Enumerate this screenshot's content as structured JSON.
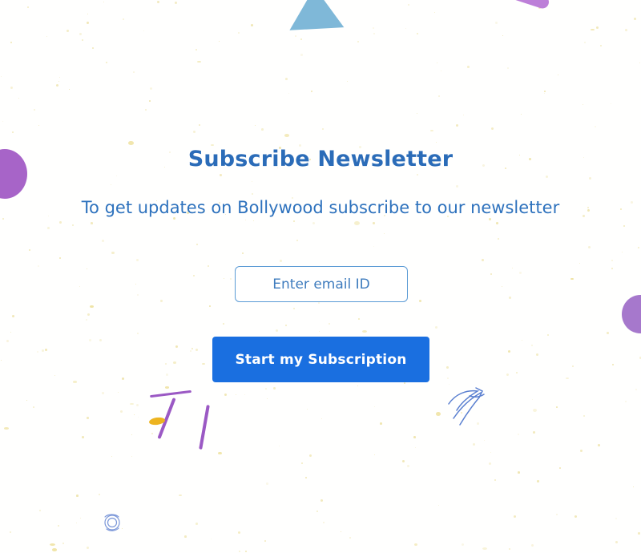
{
  "page": {
    "background_color": "#fffffe"
  },
  "newsletter": {
    "heading": "Subscribe Newsletter",
    "subheading": "To get updates on Bollywood subscribe to our newsletter",
    "email_input": {
      "placeholder": "Enter email ID",
      "value": "",
      "border_color": "#5b9bd5"
    },
    "submit_button": {
      "label": "Start my Subscription",
      "background_color": "#1a6fe0",
      "text_color": "#ffffff"
    },
    "heading_color": "#2b6cb8",
    "subheading_color": "#2e72bd"
  },
  "decorations": {
    "triangle_top": {
      "name": "blue-triangle",
      "color": "#7fb8d8"
    },
    "circle_left": {
      "name": "purple-circle-left",
      "color": "#a764c8"
    },
    "circle_right": {
      "name": "purple-circle-right",
      "color": "#a678cc"
    },
    "pill_top_right": {
      "name": "purple-pill",
      "color": "#bd7fd8"
    },
    "strokes": {
      "name": "purple-strokes",
      "color": "#9b59c4"
    },
    "blob": {
      "name": "yellow-blob",
      "color": "#edb420"
    },
    "arrow_doodle": {
      "name": "blue-arrow-scribble",
      "color": "#5a7fd0"
    },
    "circle_doodle": {
      "name": "blue-circle-scribble",
      "color": "#7a96d8"
    },
    "speckle": {
      "name": "yellow-speckle-texture",
      "color": "#e8d98a"
    }
  }
}
